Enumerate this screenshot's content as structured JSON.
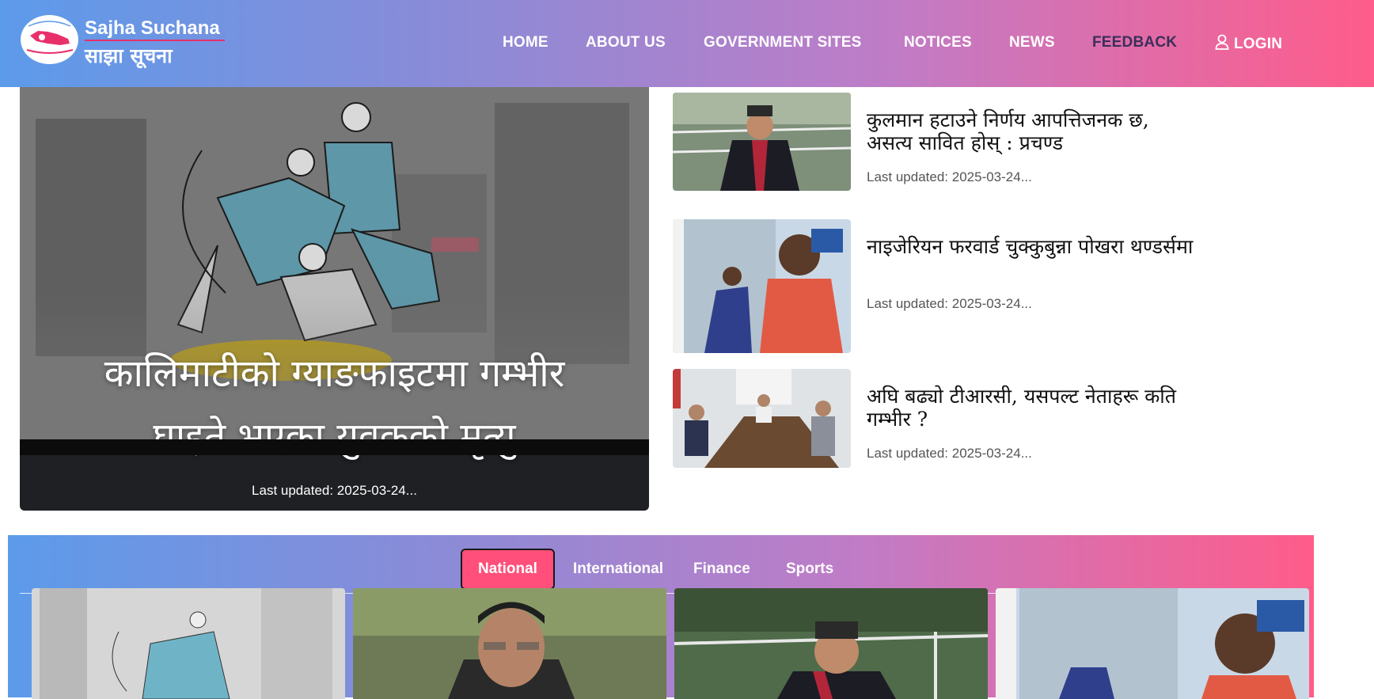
{
  "brand": {
    "name_en": "Sajha Suchana",
    "name_np": "साझा सूचना"
  },
  "nav": {
    "home": "HOME",
    "about": "ABOUT US",
    "government": "GOVERNMENT SITES",
    "notices": "NOTICES",
    "news": "NEWS",
    "feedback": "FEEDBACK",
    "login": "LOGIN"
  },
  "hero": {
    "title_line1": "कालिमाटीको ग्याङफाइटमा गम्भीर",
    "title_line2": "घाइते भएका युवकको मृत्यु",
    "updated": "Last updated: 2025-03-24..."
  },
  "side_news": [
    {
      "title": "कुलमान हटाउने निर्णय आपत्तिजनक छ, असत्य सावित होस् : प्रचण्ड",
      "updated": "Last updated: 2025-03-24..."
    },
    {
      "title": "नाइजेरियन फरवार्ड चुक्कुबुन्ना पोखरा थण्डर्समा",
      "updated": "Last updated: 2025-03-24..."
    },
    {
      "title": "अघि बढ्यो टीआरसी, यसपल्ट नेताहरू कति गम्भीर ?",
      "updated": "Last updated: 2025-03-24..."
    }
  ],
  "tabs": [
    "National",
    "International",
    "Finance",
    "Sports"
  ],
  "colors": {
    "accent": "#ff4f7a",
    "gradient_start": "#5c9bea",
    "gradient_end": "#ff5c8a"
  }
}
